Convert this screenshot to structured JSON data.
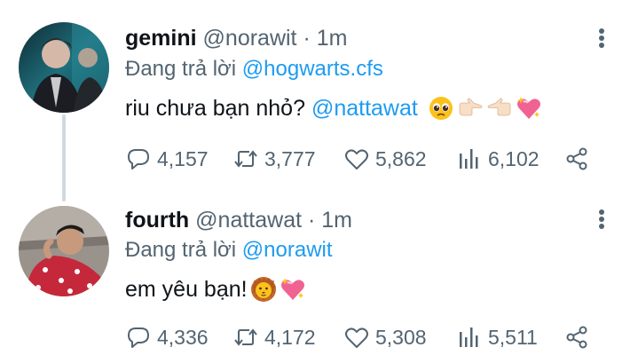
{
  "tweets": [
    {
      "name": "gemini",
      "handle": "@norawit",
      "separator": "·",
      "time": "1m",
      "reply_prefix": "Đang trả lời ",
      "reply_to": "@hogwarts.cfs",
      "text": "riu chưa bạn nhỏ? ",
      "mention": "@nattawat",
      "emojis": [
        "pleading-face",
        "pointing-right",
        "pointing-left",
        "sparkling-heart"
      ],
      "stats": {
        "replies": "4,157",
        "retweets": "3,777",
        "likes": "5,862",
        "views": "6,102"
      }
    },
    {
      "name": "fourth",
      "handle": "@nattawat",
      "separator": "·",
      "time": "1m",
      "reply_prefix": "Đang trả lời ",
      "reply_to": "@norawit",
      "text": "em yêu bạn!",
      "emojis": [
        "lion-face",
        "sparkling-heart"
      ],
      "stats": {
        "replies": "4,336",
        "retweets": "4,172",
        "likes": "5,308",
        "views": "5,511"
      }
    }
  ],
  "colors": {
    "link": "#1d9bf0",
    "secondary_text": "#536471",
    "primary_text": "#0f1419",
    "thread_line": "#cfd9de"
  }
}
